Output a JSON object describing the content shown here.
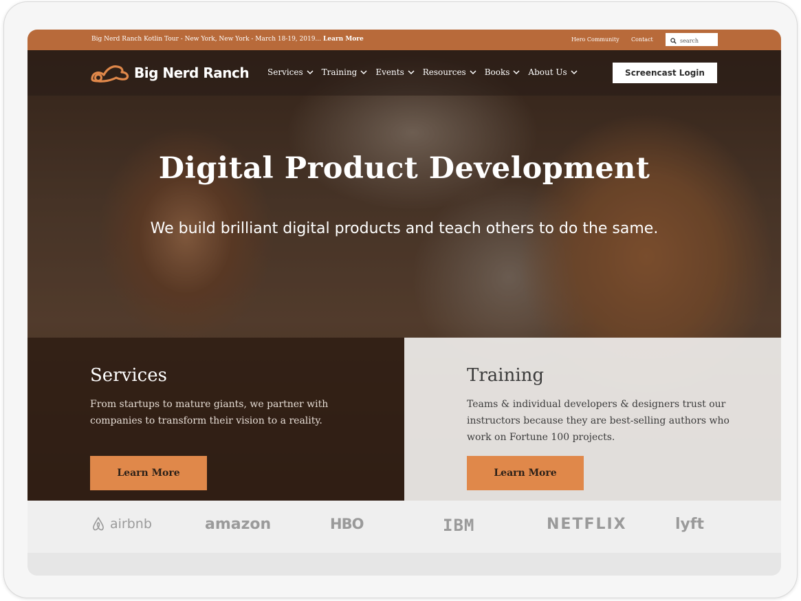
{
  "topbar": {
    "announcement": "Big Nerd Ranch Kotlin Tour - New York, New York - March 18-19, 2019...",
    "announcement_link": "Learn More",
    "hero_community": "Hero Community",
    "contact": "Contact",
    "search_placeholder": "search"
  },
  "header": {
    "brand": "Big Nerd Ranch",
    "nav": [
      {
        "label": "Services"
      },
      {
        "label": "Training"
      },
      {
        "label": "Events"
      },
      {
        "label": "Resources"
      },
      {
        "label": "Books"
      },
      {
        "label": "About Us"
      }
    ],
    "login_label": "Screencast Login"
  },
  "hero": {
    "title": "Digital Product Development",
    "subtitle": "We build brilliant digital products and teach others to do the same."
  },
  "panels": {
    "services": {
      "title": "Services",
      "body": "From startups to mature giants, we partner with companies to transform their vision to a reality.",
      "button": "Learn More"
    },
    "training": {
      "title": "Training",
      "body": "Teams & individual developers & designers trust our instructors because they are best-selling authors who work on Fortune 100 projects.",
      "button": "Learn More"
    }
  },
  "clients": {
    "airbnb": "airbnb",
    "amazon": "amazon",
    "hbo": "HBO",
    "ibm": "IBM",
    "netflix": "NETFLIX",
    "lyft": "lyft"
  },
  "colors": {
    "accent": "#e0884a",
    "topbar": "#b86a3a"
  }
}
